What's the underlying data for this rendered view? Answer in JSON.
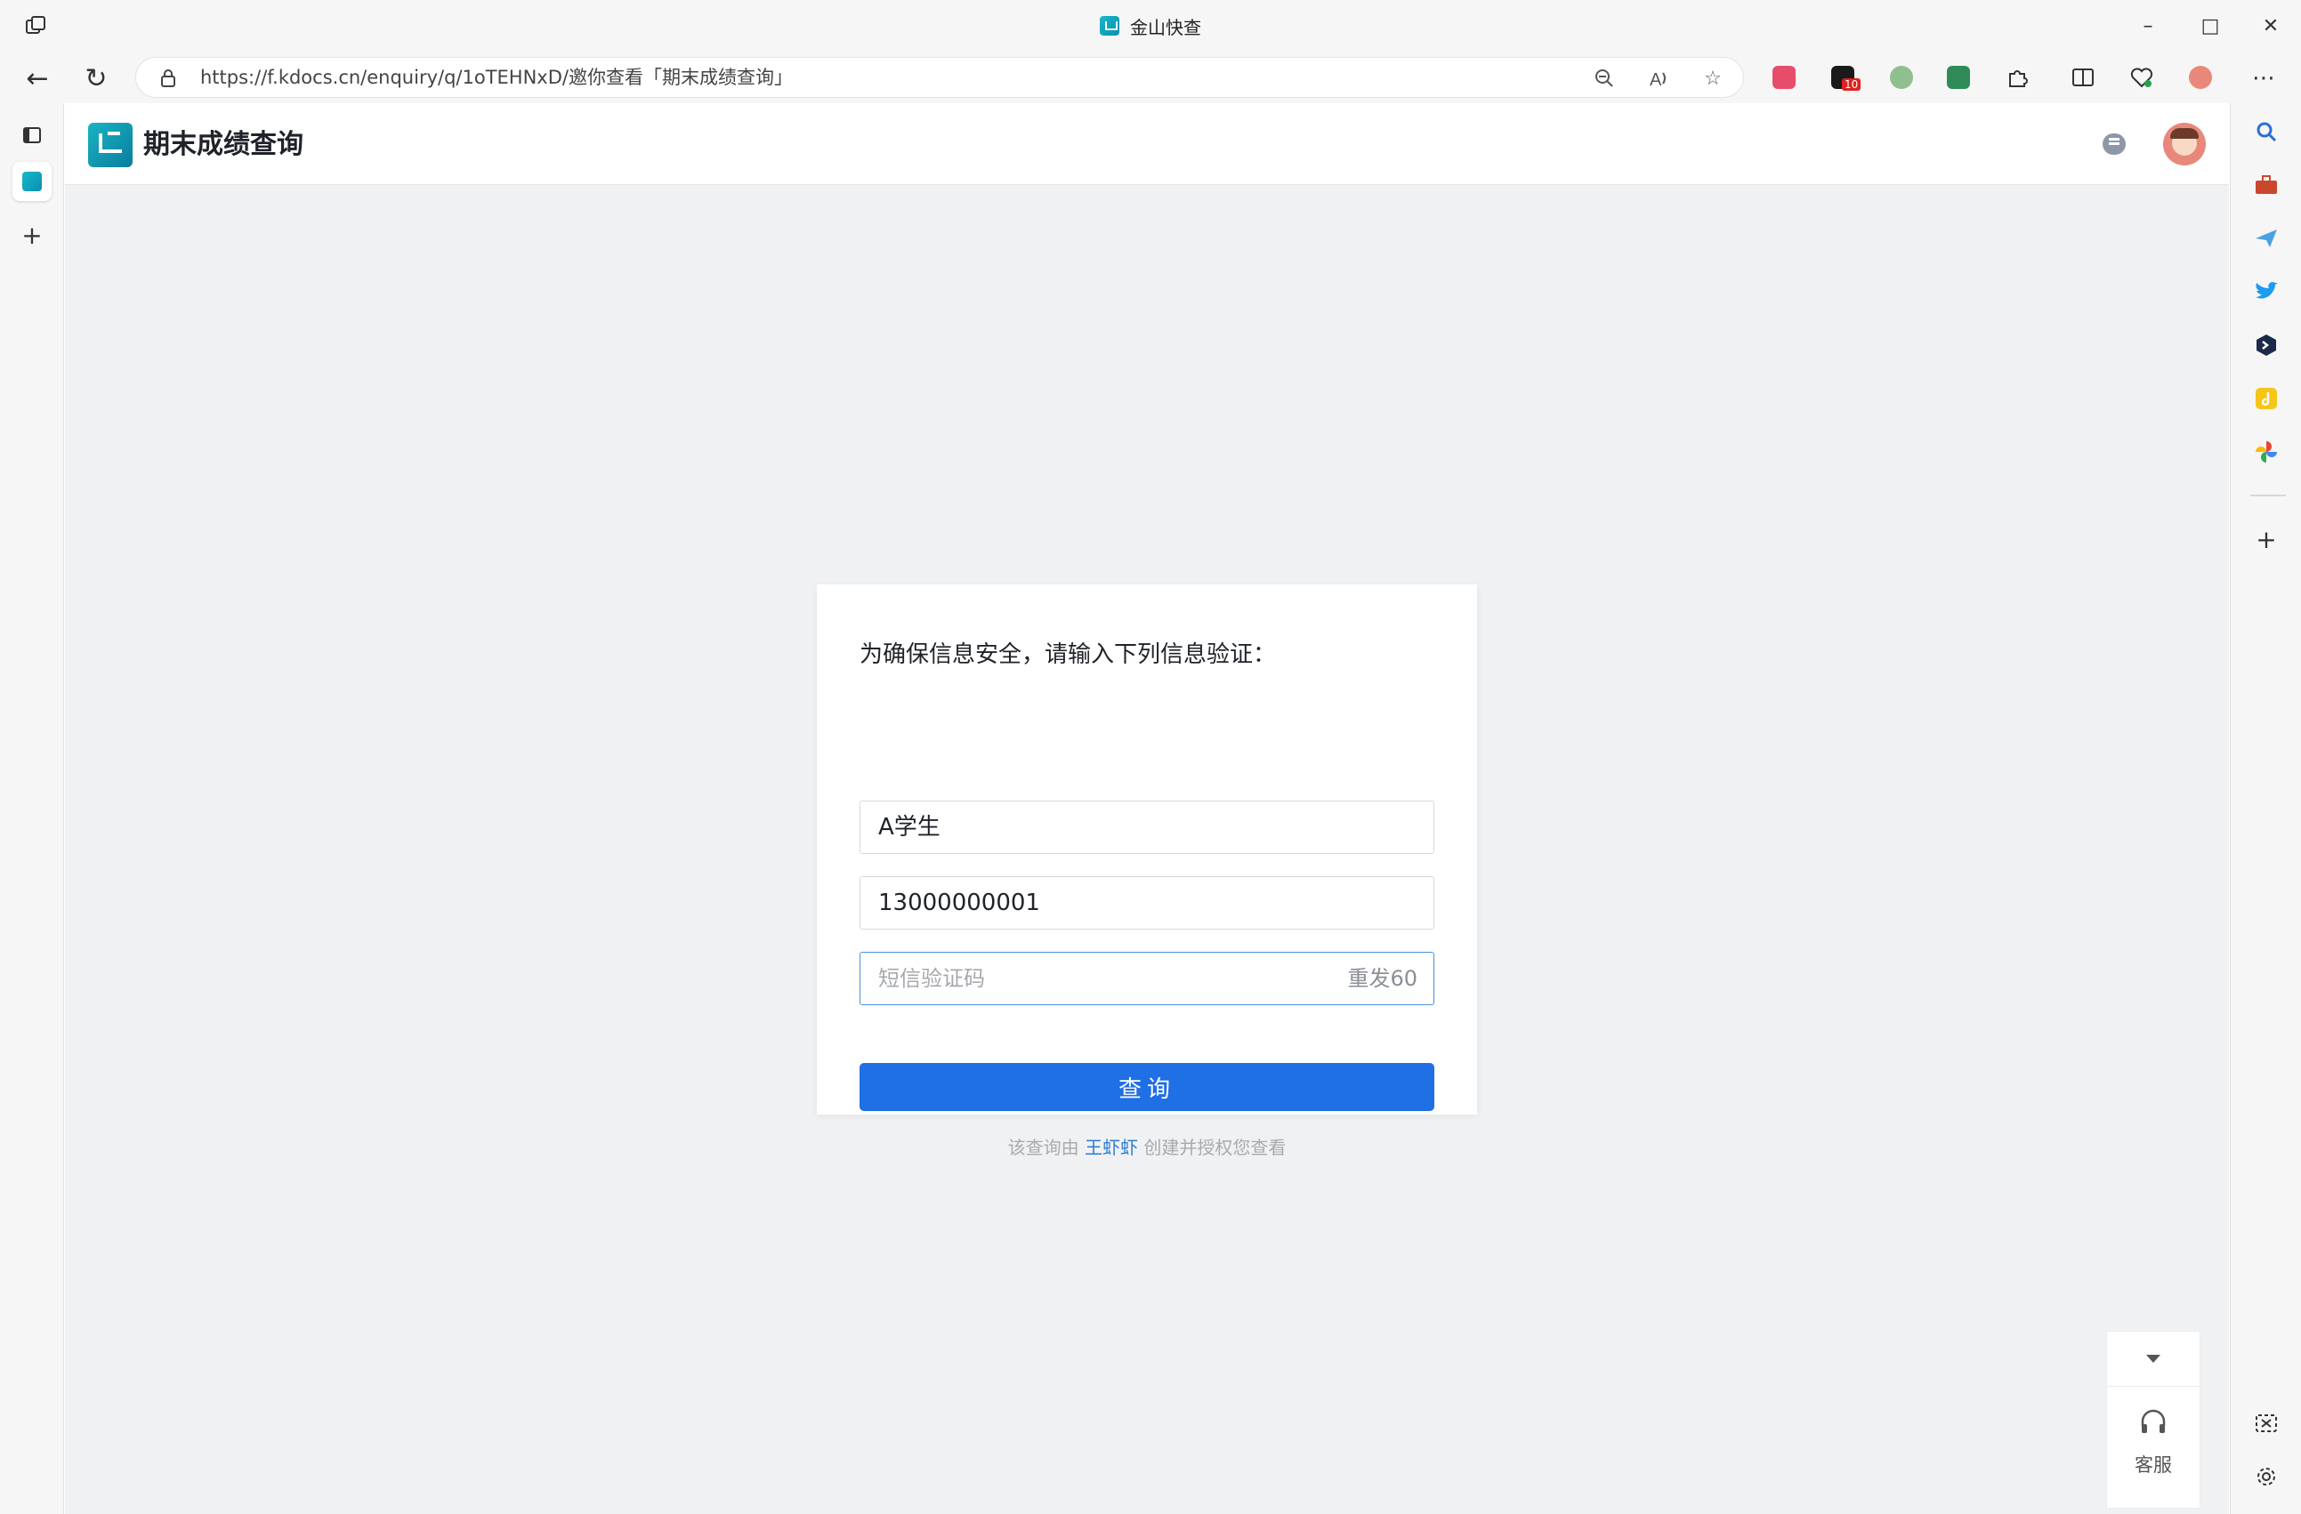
{
  "window": {
    "title": "金山快查"
  },
  "address_bar": {
    "url": "https://f.kdocs.cn/enquiry/q/1oTEHNxD/邀你查看「期末成绩查询」"
  },
  "extensions": {
    "badge_count": "10"
  },
  "app": {
    "title": "期末成绩查询"
  },
  "form": {
    "prompt": "为确保信息安全，请输入下列信息验证：",
    "name_value": "A学生",
    "phone_value": "13000000001",
    "sms_placeholder": "短信验证码",
    "resend_label": "重发60",
    "submit_label": "查询",
    "credit_prefix": "该查询由",
    "credit_author": "王虾虾",
    "credit_suffix": "创建并授权您查看"
  },
  "float_panel": {
    "service_label": "客服"
  },
  "colors": {
    "primary_button": "#1f6fe5",
    "author_link": "#2a7bd5",
    "page_background": "#f0f1f3"
  }
}
